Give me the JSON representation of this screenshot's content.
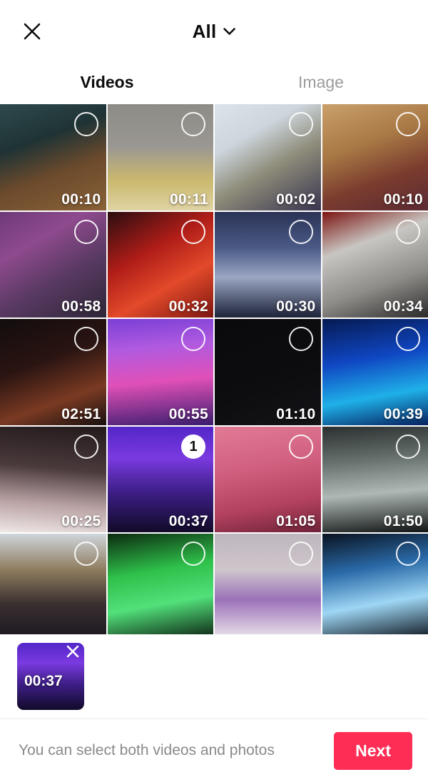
{
  "header": {
    "close_icon": "close-icon",
    "album_label": "All",
    "chevron_icon": "chevron-down-icon"
  },
  "tabs": [
    {
      "label": "Videos",
      "active": true
    },
    {
      "label": "Image",
      "active": false
    }
  ],
  "colors": {
    "accent": "#fd2d55",
    "text_primary": "#0d0d0d",
    "text_muted": "#8a8a8a",
    "tab_inactive": "#9c9c9c",
    "divider": "#ececec",
    "background": "#ffffff"
  },
  "grid": {
    "columns": 4,
    "items": [
      {
        "duration": "00:10",
        "selected": false,
        "order": null,
        "scene": "black-dog-on-wood-floor",
        "g": "linear-gradient(160deg,#2e4a4d 0%,#1f3335 34%,#6b4a2c 62%,#8a6238 100%)"
      },
      {
        "duration": "00:11",
        "selected": false,
        "order": null,
        "scene": "tan-dog-lying-on-carpet",
        "g": "linear-gradient(180deg,#8e8c86 0%,#9a9792 40%,#cbb96e 72%,#dfd3a4 100%)"
      },
      {
        "duration": "00:02",
        "selected": false,
        "order": null,
        "scene": "pug-costume-on-chair",
        "g": "linear-gradient(150deg,#dbe4ea 0%,#cdd6dd 30%,#8e8c7a 58%,#3a3550 100%)"
      },
      {
        "duration": "00:10",
        "selected": false,
        "order": null,
        "scene": "dog-on-patterned-blanket",
        "g": "linear-gradient(160deg,#caa06a 0%,#a87845 38%,#7a3c2e 68%,#5c2a33 100%)"
      },
      {
        "duration": "00:58",
        "selected": false,
        "order": null,
        "scene": "band-on-purple-lit-stage",
        "g": "linear-gradient(150deg,#6e3a78 0%,#8e4a8e 30%,#5a3a63 60%,#2e2638 100%)"
      },
      {
        "duration": "00:32",
        "selected": false,
        "order": null,
        "scene": "red-lit-performer",
        "g": "linear-gradient(150deg,#2a0d10 0%,#b01d18 38%,#e24a2a 66%,#7d1510 100%)"
      },
      {
        "duration": "00:30",
        "selected": false,
        "order": null,
        "scene": "concert-stage-with-screen",
        "g": "linear-gradient(180deg,#2a3356 0%,#4b5a86 34%,#9aa6c2 62%,#1d2238 100%)"
      },
      {
        "duration": "00:34",
        "selected": false,
        "order": null,
        "scene": "stage-truss-white-screen",
        "g": "linear-gradient(160deg,#7d1512 0%,#c8c6c2 32%,#8e8c88 66%,#2b2b2b 100%)"
      },
      {
        "duration": "02:51",
        "selected": false,
        "order": null,
        "scene": "dark-stage-with-flame",
        "g": "linear-gradient(160deg,#120d0d 0%,#2a1412 40%,#7a3a22 72%,#1a1010 100%)"
      },
      {
        "duration": "00:55",
        "selected": false,
        "order": null,
        "scene": "purple-laser-stage",
        "g": "linear-gradient(175deg,#7a3fd6 0%,#b05ae0 28%,#e050b8 58%,#3b1d6e 100%)"
      },
      {
        "duration": "01:10",
        "selected": false,
        "order": null,
        "scene": "black-frame",
        "g": "linear-gradient(160deg,#0a0a0c 0%,#0d0d10 60%,#141418 100%)"
      },
      {
        "duration": "00:39",
        "selected": false,
        "order": null,
        "scene": "blue-led-stage",
        "g": "linear-gradient(170deg,#061a52 0%,#0f46c2 38%,#1fb0e8 70%,#07205e 100%)"
      },
      {
        "duration": "00:25",
        "selected": false,
        "order": null,
        "scene": "smoky-white-stage-lights",
        "g": "linear-gradient(185deg,#231a1c 0%,#4a3a3c 40%,#b9a2a4 72%,#efe7e6 100%)"
      },
      {
        "duration": "00:37",
        "selected": true,
        "order": "1",
        "scene": "purple-stage-beam",
        "g": "linear-gradient(180deg,#5326c8 0%,#7a3ae0 30%,#3d1e86 62%,#120a28 100%)"
      },
      {
        "duration": "01:05",
        "selected": false,
        "order": null,
        "scene": "pink-stage-singer",
        "g": "linear-gradient(170deg,#e07a95 0%,#d05f7e 40%,#b2415e 72%,#6e2238 100%)"
      },
      {
        "duration": "01:50",
        "selected": false,
        "order": null,
        "scene": "spotlight-beams-over-band",
        "g": "linear-gradient(175deg,#2a3030 0%,#6a7470 34%,#aeb8b4 62%,#101414 100%)"
      },
      {
        "duration": "",
        "selected": false,
        "order": null,
        "scene": "outdoor-stage-bright-sky",
        "g": "linear-gradient(180deg,#cfd6dc 0%,#8e7c5e 34%,#3a3030 66%,#1a1620 100%)"
      },
      {
        "duration": "",
        "selected": false,
        "order": null,
        "scene": "green-laser-stage",
        "g": "linear-gradient(170deg,#0c2a10 0%,#2ec04a 36%,#52e07a 64%,#0a1a0e 100%)"
      },
      {
        "duration": "",
        "selected": false,
        "order": null,
        "scene": "smoke-with-yellow-flag",
        "g": "linear-gradient(180deg,#bdb6bc 0%,#cfc6cc 34%,#9a72b8 62%,#efe9ec 100%)"
      },
      {
        "duration": "",
        "selected": false,
        "order": null,
        "scene": "blue-white-led-wall",
        "g": "linear-gradient(170deg,#0a1220 0%,#2a6aa8 34%,#9ed6f4 64%,#0a1018 100%)"
      }
    ]
  },
  "tray": {
    "items": [
      {
        "duration": "00:37",
        "remove_icon": "close-icon",
        "scene": "purple-stage-beam",
        "g": "linear-gradient(180deg,#5326c8 0%,#7a3ae0 30%,#3d1e86 62%,#120a28 100%)"
      }
    ]
  },
  "bottom": {
    "hint": "You can select both videos and photos",
    "next_label": "Next"
  }
}
